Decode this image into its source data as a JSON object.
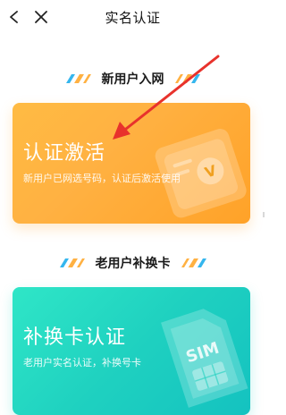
{
  "nav": {
    "title": "实名认证",
    "back_icon": "chevron-left-icon",
    "close_icon": "close-icon"
  },
  "sections": [
    {
      "heading": "新用户入网",
      "card": {
        "title": "认证激活",
        "description": "新用户已网选号码，认证后激活使用",
        "icon": "id-card-v-icon"
      }
    },
    {
      "heading": "老用户补换卡",
      "card": {
        "title": "补换卡认证",
        "description": "老用户实名认证，补换号卡",
        "icon": "sim-card-icon",
        "icon_text": "SIM"
      }
    }
  ],
  "colors": {
    "orange_card": "#ffb142",
    "teal_card": "#1fd1c0",
    "annotation_arrow": "#e8322c",
    "stripe_orange": "#ffb142",
    "stripe_blue": "#35b6ee"
  }
}
